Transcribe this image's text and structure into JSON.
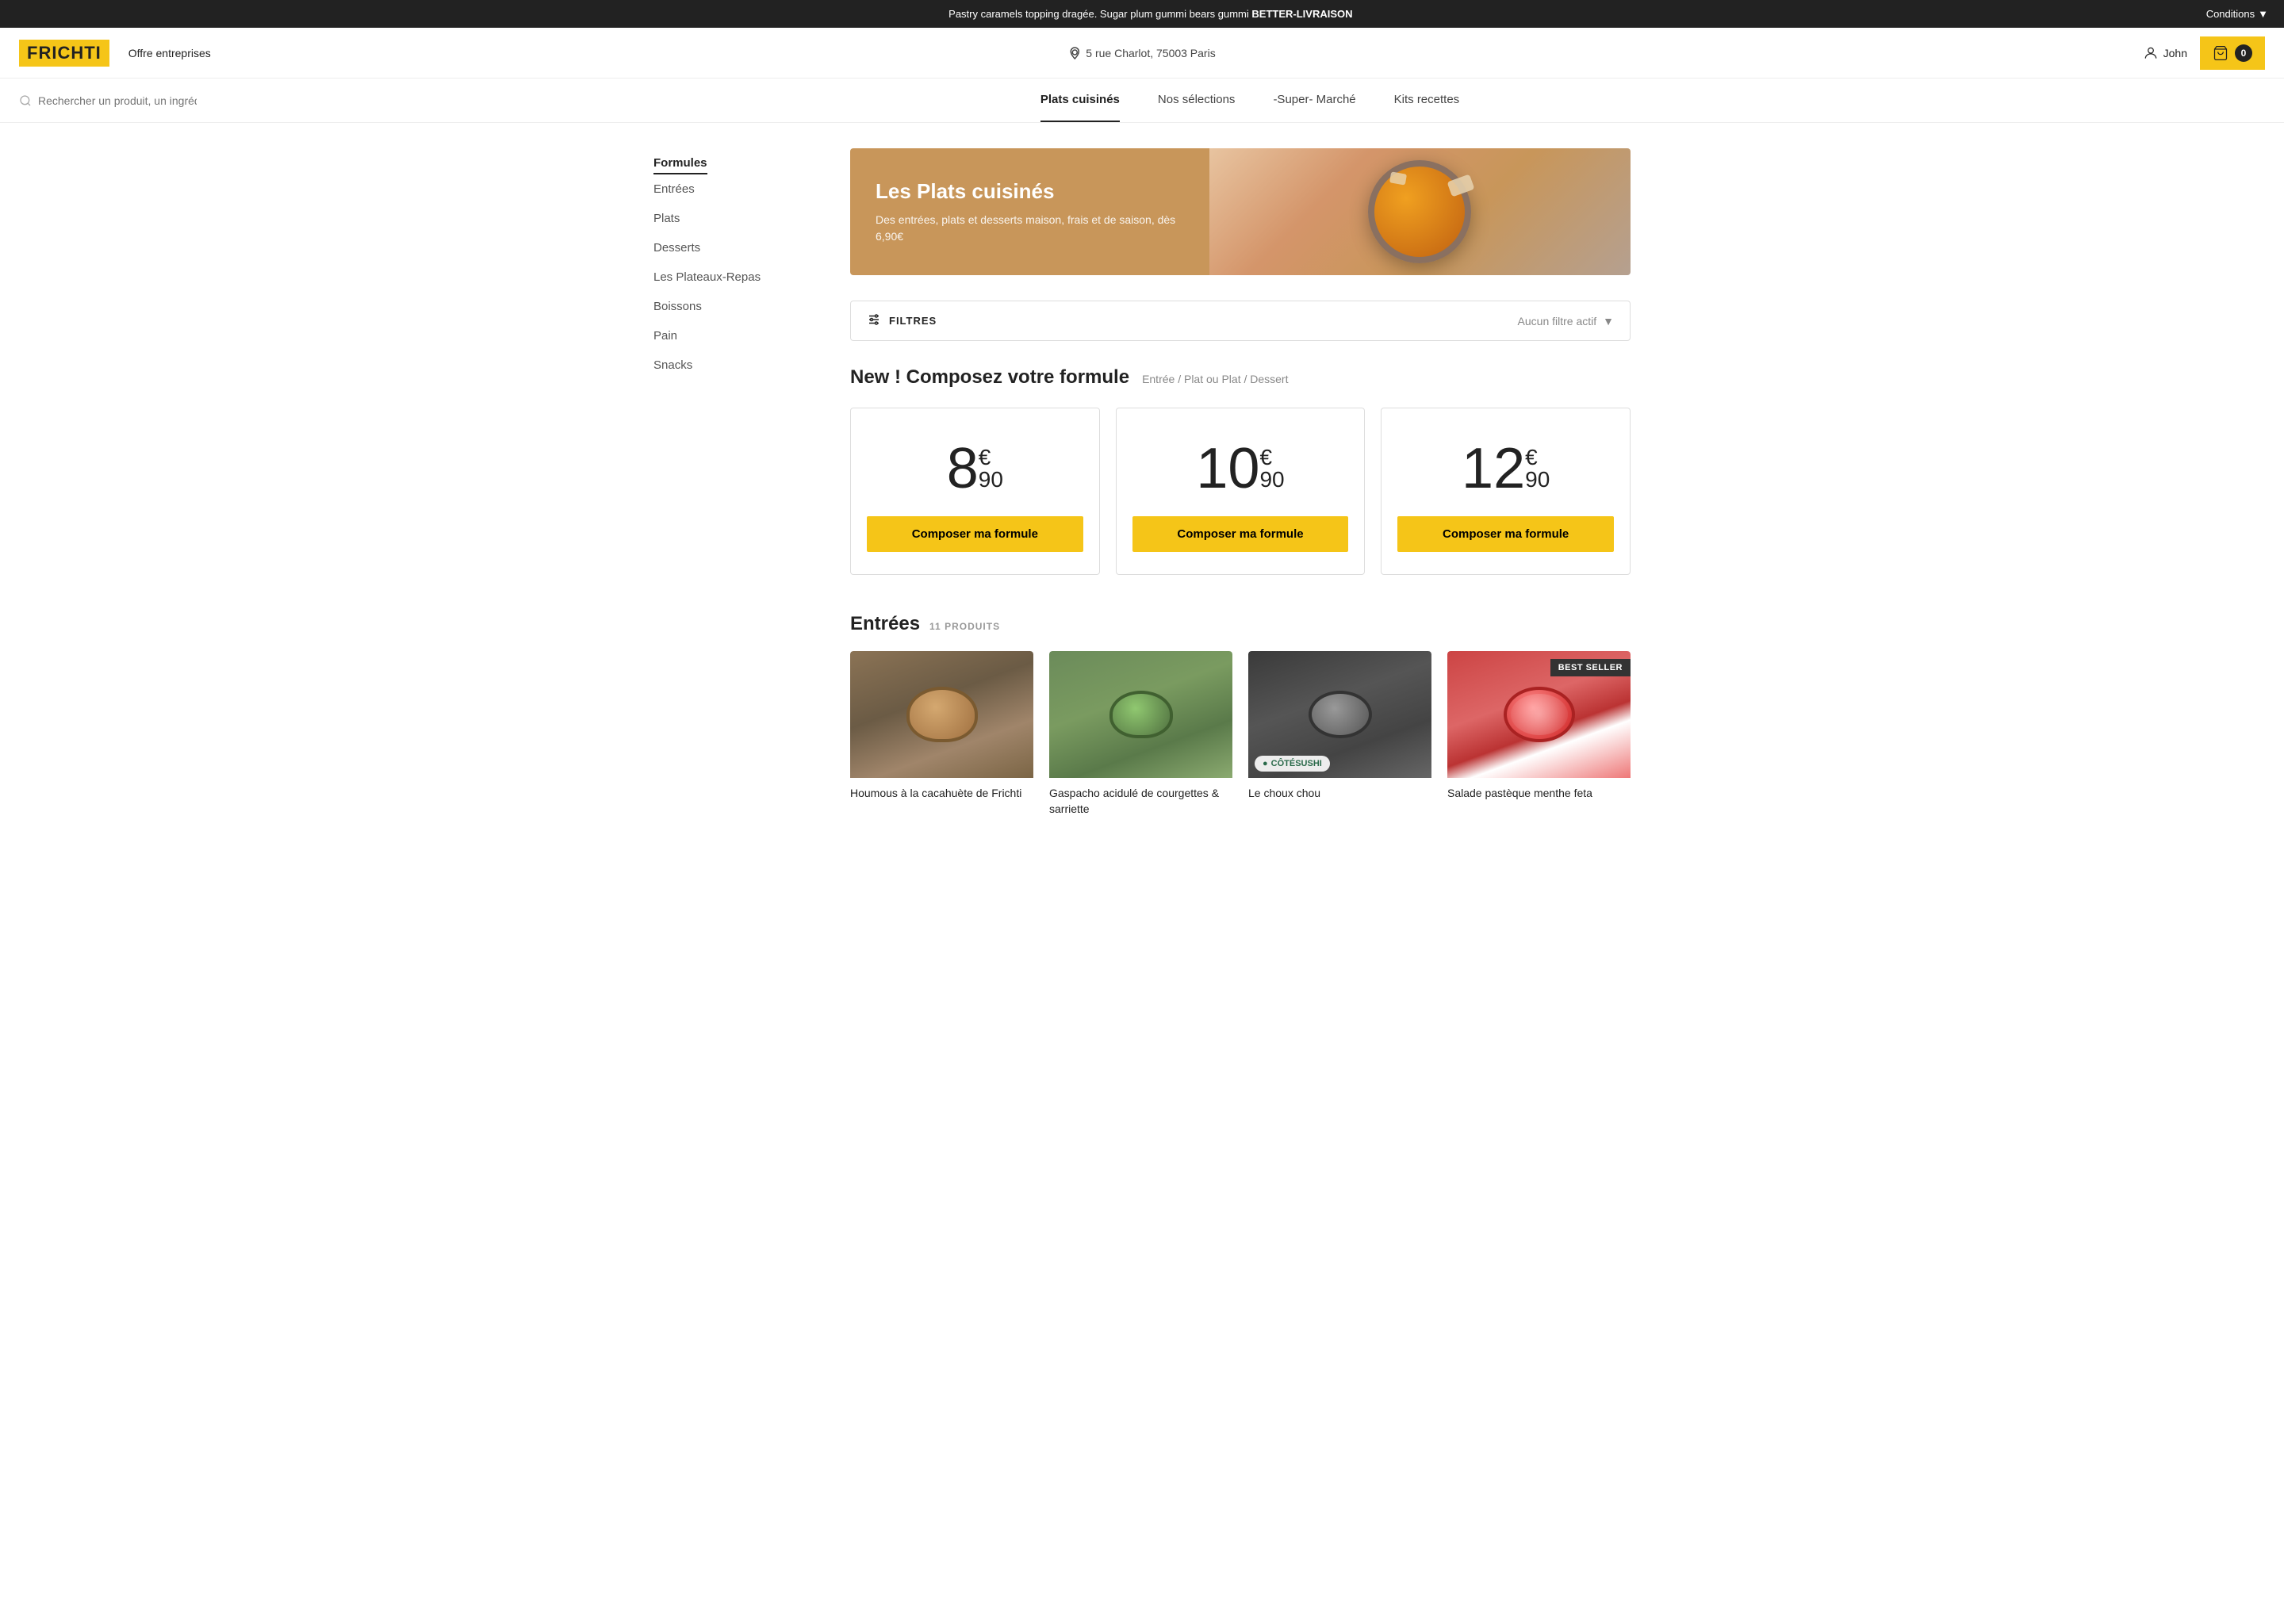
{
  "banner": {
    "text": "Pastry caramels topping dragée. Sugar plum gummi bears gummi",
    "highlight": "BETTER-LIVRAISON",
    "conditions_label": "Conditions"
  },
  "header": {
    "logo": "FRICHTI",
    "offre": "Offre entreprises",
    "address": "5 rue Charlot, 75003 Paris",
    "user_name": "John",
    "cart_count": "0"
  },
  "nav": {
    "search_placeholder": "Rechercher un produit, un ingrédient...",
    "links": [
      {
        "label": "Plats cuisinés",
        "active": true
      },
      {
        "label": "Nos sélections",
        "active": false
      },
      {
        "label": "-Super- Marché",
        "active": false
      },
      {
        "label": "Kits recettes",
        "active": false
      }
    ]
  },
  "sidebar": {
    "items": [
      {
        "label": "Formules",
        "active": true
      },
      {
        "label": "Entrées",
        "active": false
      },
      {
        "label": "Plats",
        "active": false
      },
      {
        "label": "Desserts",
        "active": false
      },
      {
        "label": "Les Plateaux-Repas",
        "active": false
      },
      {
        "label": "Boissons",
        "active": false
      },
      {
        "label": "Pain",
        "active": false
      },
      {
        "label": "Snacks",
        "active": false
      }
    ]
  },
  "hero": {
    "title": "Les Plats cuisinés",
    "description": "Des entrées, plats et desserts maison, frais et de saison, dès 6,90€"
  },
  "filters": {
    "label": "FILTRES",
    "active_label": "Aucun filtre actif"
  },
  "formules": {
    "section_title": "New ! Composez votre formule",
    "subtitle": "Entrée / Plat  ou  Plat / Dessert",
    "cards": [
      {
        "price_main": "8",
        "price_cents": "90",
        "btn_label": "Composer ma formule"
      },
      {
        "price_main": "10",
        "price_cents": "90",
        "btn_label": "Composer ma formule"
      },
      {
        "price_main": "12",
        "price_cents": "90",
        "btn_label": "Composer ma formule"
      }
    ]
  },
  "entrees": {
    "title": "Entrées",
    "count": "11 PRODUITS",
    "products": [
      {
        "name": "Houmous à la cacahuète de Frichti",
        "badge": null,
        "brand": null,
        "img_class": "food-houmous"
      },
      {
        "name": "Gaspacho acidulé de courgettes & sarriette",
        "badge": null,
        "brand": null,
        "img_class": "food-gaspacho"
      },
      {
        "name": "Le choux chou",
        "badge": null,
        "brand": "CÔTÉSUSHI",
        "img_class": "food-choux"
      },
      {
        "name": "Salade pastèque menthe feta",
        "badge": "BEST SELLER",
        "brand": null,
        "img_class": "food-salade"
      }
    ]
  }
}
